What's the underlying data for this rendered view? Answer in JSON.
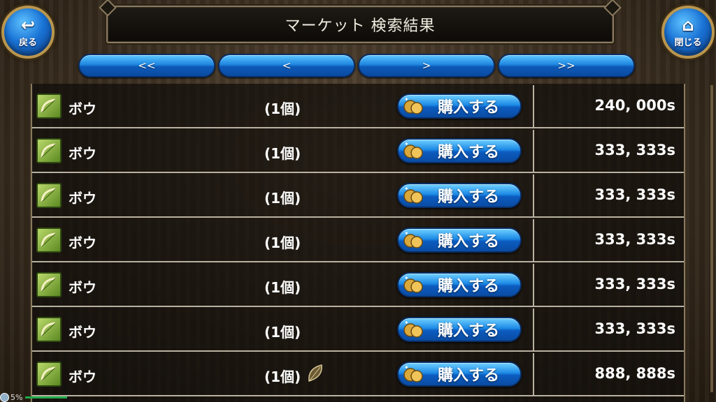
{
  "header": {
    "title": "マーケット 検索結果",
    "back_label": "戻る",
    "close_label": "閉じる"
  },
  "pager": {
    "first": "<<",
    "prev": "<",
    "next": ">",
    "last": ">>"
  },
  "buy_label": "購入する",
  "rows": [
    {
      "name": "ボウ",
      "qty": "(1個)",
      "price": "240, 000s",
      "leaf": false
    },
    {
      "name": "ボウ",
      "qty": "(1個)",
      "price": "333, 333s",
      "leaf": false
    },
    {
      "name": "ボウ",
      "qty": "(1個)",
      "price": "333, 333s",
      "leaf": false
    },
    {
      "name": "ボウ",
      "qty": "(1個)",
      "price": "333, 333s",
      "leaf": false
    },
    {
      "name": "ボウ",
      "qty": "(1個)",
      "price": "333, 333s",
      "leaf": false
    },
    {
      "name": "ボウ",
      "qty": "(1個)",
      "price": "333, 333s",
      "leaf": false
    },
    {
      "name": "ボウ",
      "qty": "(1個)",
      "price": "888, 888s",
      "leaf": true
    }
  ],
  "status": {
    "battery": "5%"
  },
  "colors": {
    "button_blue": "#1d8ae6",
    "item_green": "#8bb840",
    "frame_gold": "#8a7a5e"
  }
}
